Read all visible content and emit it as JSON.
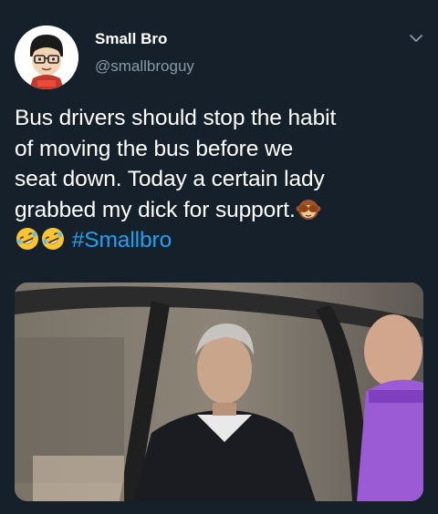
{
  "user": {
    "display_name": "Small Bro",
    "handle": "@smallbroguy"
  },
  "tweet": {
    "lines": [
      "Bus drivers should stop the habit",
      "of moving the bus before we",
      "seat down. Today a certain lady",
      "grabbed my dick for support."
    ],
    "hashtag": "#Smallbro",
    "emojis": [
      "see-no-evil-monkey",
      "rolling-on-floor-laughing",
      "rolling-on-floor-laughing"
    ]
  },
  "media": {
    "description_icon": "photo"
  },
  "colors": {
    "background": "#15202b",
    "text": "#ffffff",
    "secondary": "#8899a6",
    "link": "#1da1f2"
  }
}
